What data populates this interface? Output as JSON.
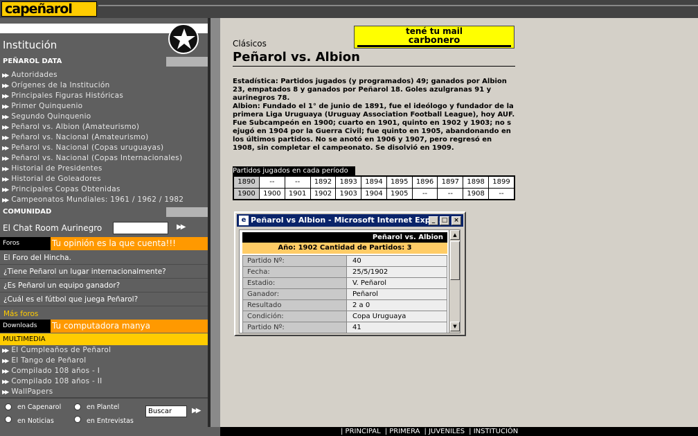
{
  "header": {
    "logo_text": "capeñarol"
  },
  "sidebar": {
    "title": "Institución",
    "sections": {
      "data": "PEÑAROL DATA",
      "comunidad": "COMUNIDAD",
      "multimedia": "MULTIMEDIA"
    },
    "data_items": [
      "Autoridades",
      "Orígenes de la Institución",
      "Principales Figuras Históricas",
      "Primer Quinquenio",
      "Segundo Quinquenio",
      "Peñarol vs. Albion (Amateurismo)",
      "Peñarol vs. Nacional (Amateurismo)",
      "Peñarol vs. Nacional (Copas uruguayas)",
      "Peñarol vs. Nacional (Copas Internacionales)",
      "Historial de Presidentes",
      "Historial de Goleadores",
      "Principales Copas Obtenidas",
      "Campeonatos Mundiales: 1961 / 1962 / 1982"
    ],
    "chat_label": "El Chat Room Aurinegro",
    "foros_tag": "Foros",
    "foros_msg": "Tu opinión es la que cuenta!!!",
    "forum_items": [
      "El Foro del Hincha.",
      "¿Tiene Peñarol un lugar internacionalmente?",
      "¿Es Peñarol un equipo ganador?",
      "¿Cuál es el fútbol que juega Peñarol?"
    ],
    "mas_foros": "Más foros",
    "downloads_tag": "Downloads",
    "downloads_msg": "Tu computadora manya",
    "multimedia_items": [
      "El Cumpleaños de Peñarol",
      "El Tango de Peñarol",
      "Compilado 108 años - I",
      "Compilado 108 años - II",
      "WallPapers"
    ],
    "search": {
      "options": [
        "en Capenarol",
        "en Plantel",
        "en Noticias",
        "en Entrevistas"
      ],
      "value": "Buscar"
    }
  },
  "banner": {
    "line1": "mail",
    "line1_full": "tené tu mail",
    "line2": "carbonero"
  },
  "main": {
    "section": "Clásicos",
    "title": "Peñarol vs. Albion",
    "body": "Estadística: Partidos jugados (y programados) 49; ganados por Albion 23, empatados 8 y ganados por Peñarol 18. Goles azulgranas 91 y aurinegros 78.",
    "body2": "Albion: Fundado el 1° de junio de 1891, fue el ideólogo y fundador de la primera Liga Uruguaya (Uruguay Association Football League), hoy AUF. Fue Subcampeón en 1900; cuarto en 1901, quinto en 1902 y 1903; no s ejugó en 1904 por la Guerra Civil; fue quinto en 1905, abandonando en los últimos partidos. No se anotó en 1906 y 1907, pero regresó en 1908, sin completar el campeonato. Se disolvió en 1909.",
    "period_caption": "Partidos jugados en cada período",
    "period_rows": [
      [
        "1890",
        "--",
        "--",
        "1892",
        "1893",
        "1894",
        "1895",
        "1896",
        "1897",
        "1898",
        "1899"
      ],
      [
        "1900",
        "1900",
        "1901",
        "1902",
        "1903",
        "1904",
        "1905",
        "--",
        "--",
        "1908",
        "--"
      ]
    ]
  },
  "popup": {
    "window_title": "Peñarol vs Albion - Microsoft Internet Expl...",
    "header": "Peñarol vs. Albion",
    "subheader": "Año: 1902   Cantidad de Partidos: 3",
    "rows": [
      [
        "Partido Nº:",
        "40"
      ],
      [
        "Fecha:",
        "25/5/1902"
      ],
      [
        "Estadio:",
        "V. Peñarol"
      ],
      [
        "Ganador:",
        "Peñarol"
      ],
      [
        "Resultado",
        "2 a 0"
      ],
      [
        "Condición:",
        "Copa Uruguaya"
      ],
      [
        "Partido Nº:",
        "41"
      ]
    ]
  },
  "footer": {
    "links": [
      "| PRINCIPAL",
      "| PRIMERA",
      "| JUVENILES",
      "| INSTITUCIÓN"
    ]
  }
}
